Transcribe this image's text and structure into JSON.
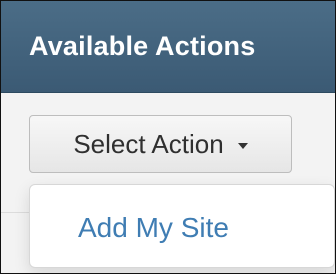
{
  "panel": {
    "title": "Available Actions"
  },
  "action_button": {
    "label": "Select Action",
    "icon": "chevron-down-icon"
  },
  "dropdown": {
    "items": [
      {
        "label": "Add My Site"
      }
    ]
  },
  "colors": {
    "header_bg": "#446681",
    "header_text": "#ffffff",
    "link": "#3f7db3",
    "button_bg": "#efefef",
    "page_bg": "#f3f3f3"
  }
}
